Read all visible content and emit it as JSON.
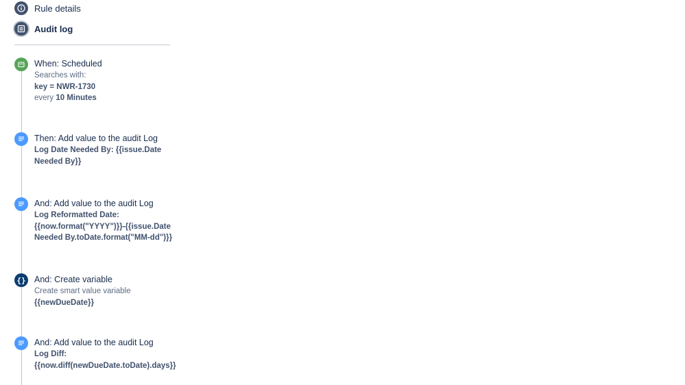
{
  "nav": {
    "rule_details": "Rule details",
    "audit_log": "Audit log"
  },
  "colors": {
    "trigger_green": "#57a55a",
    "action_blue": "#4c9aff",
    "variable_navy": "#0c3e71",
    "nav_dark": "#42526e"
  },
  "steps": [
    {
      "icon": "clock-icon",
      "title": "When: Scheduled",
      "searches_label": "Searches with:",
      "query": "key = NWR-1730",
      "every_label": "every",
      "interval": "10 Minutes"
    },
    {
      "icon": "log-icon",
      "title": "Then: Add value to the audit Log",
      "detail_line1": "Log Date Needed By: {{issue.Date",
      "detail_line2": "Needed By}}"
    },
    {
      "icon": "log-icon",
      "title": "And: Add value to the audit Log",
      "detail_line1": "Log Reformatted Date:",
      "detail_line2": "{{now.format(\"YYYY\")}}-{{issue.Date",
      "detail_line3": "Needed By.toDate.format(\"MM-dd\")}}"
    },
    {
      "icon": "variable-icon",
      "title": "And: Create variable",
      "desc": "Create smart value variable",
      "var_name": "{{newDueDate}}"
    },
    {
      "icon": "log-icon",
      "title": "And: Add value to the audit Log",
      "detail_line1": "Log Diff:",
      "detail_line2": "{{now.diff(newDueDate.toDate).days}}"
    }
  ]
}
